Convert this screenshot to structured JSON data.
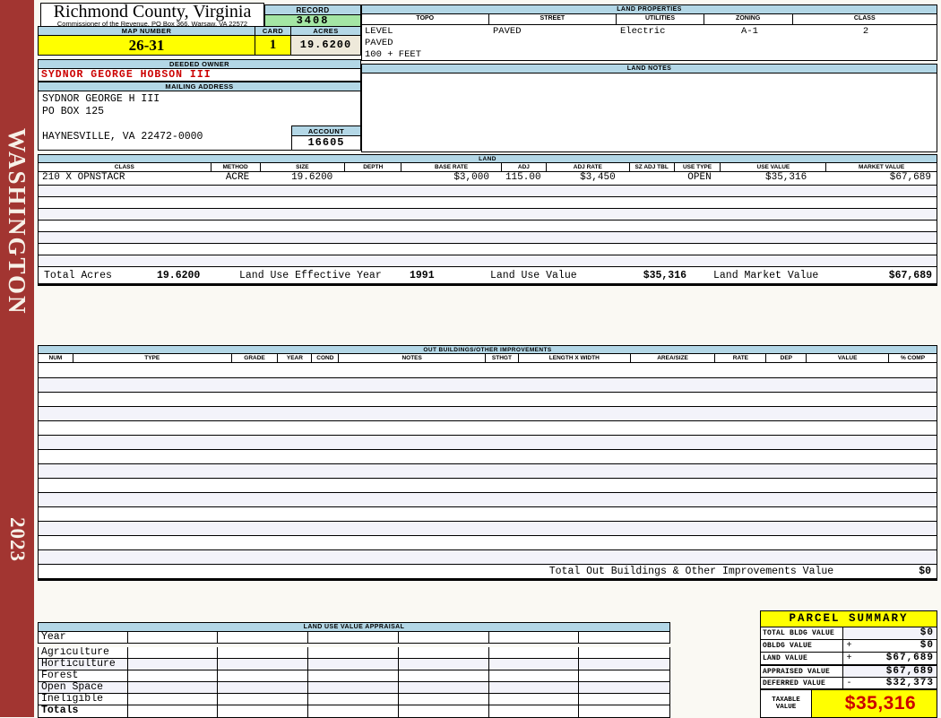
{
  "colors": {
    "sidebar_red": "#a23531",
    "header_blue": "#b3d7e6",
    "record_green": "#a4e6a4",
    "accent_yellow": "#ffff00",
    "acres_beige": "#eee9da",
    "owner_red": "#cc0000",
    "row_stripe": "#f3f3fa"
  },
  "sidebar": {
    "district": "WASHINGTON",
    "year": "2023"
  },
  "header": {
    "title": "Richmond County, Virginia",
    "subtitle": "Commissioner of the Revenue, PO Box 366, Warsaw, VA 22572",
    "record_label": "RECORD",
    "record_value": "3408",
    "map_number_label": "MAP NUMBER",
    "map_number": "26-31",
    "card_label": "CARD",
    "card": "1",
    "acres_label": "ACRES",
    "acres": "19.6200"
  },
  "land_properties": {
    "title": "LAND PROPERTIES",
    "columns": [
      "TOPO",
      "STREET",
      "UTILITIES",
      "ZONING",
      "CLASS"
    ],
    "topo_lines": [
      "LEVEL",
      "PAVED",
      "100 + FEET"
    ],
    "street": "PAVED",
    "utilities": "Electric",
    "zoning": "A-1",
    "class": "2"
  },
  "owner": {
    "deeded_owner_label": "DEEDED OWNER",
    "deeded_owner": "SYDNOR GEORGE HOBSON III",
    "mailing_address_label": "MAILING ADDRESS",
    "mailing_lines": [
      "SYDNOR GEORGE H III",
      "PO BOX 125",
      "",
      "HAYNESVILLE, VA 22472-0000"
    ],
    "account_label": "ACCOUNT",
    "account": "16605"
  },
  "land_notes": {
    "title": "LAND NOTES"
  },
  "land_table": {
    "title": "LAND",
    "columns": [
      "CLASS",
      "METHOD",
      "SIZE",
      "DEPTH",
      "BASE RATE",
      "ADJ",
      "ADJ RATE",
      "SZ ADJ TBL",
      "USE TYPE",
      "USE VALUE",
      "MARKET VALUE"
    ],
    "rows": [
      [
        "210 X OPNSTACR",
        "ACRE",
        "19.6200",
        "",
        "$3,000",
        "115.00",
        "$3,450",
        "",
        "OPEN",
        "$35,316",
        "$67,689"
      ]
    ],
    "empty_row_count": 7,
    "totals": {
      "total_acres_label": "Total Acres",
      "total_acres": "19.6200",
      "effective_year_label": "Land Use Effective Year",
      "effective_year": "1991",
      "use_value_label": "Land Use Value",
      "use_value": "$35,316",
      "market_value_label": "Land Market Value",
      "market_value": "$67,689"
    }
  },
  "out_buildings": {
    "title": "OUT BUILDINGS/OTHER IMPROVEMENTS",
    "columns": [
      "NUM",
      "TYPE",
      "GRADE",
      "YEAR",
      "COND",
      "NOTES",
      "STHGT",
      "LENGTH X WIDTH",
      "AREA/SIZE",
      "RATE",
      "DEP",
      "VALUE",
      "% COMP"
    ],
    "empty_row_count": 14,
    "total_label": "Total Out Buildings & Other Improvements Value",
    "total_value": "$0"
  },
  "land_use_appraisal": {
    "title": "LAND USE VALUE APPRAISAL",
    "row_labels": [
      "Year",
      "Agriculture",
      "Horticulture",
      "Forest",
      "Open Space",
      "Ineligible",
      "Totals"
    ],
    "data_column_count": 6
  },
  "parcel_summary": {
    "title": "PARCEL SUMMARY",
    "rows": [
      {
        "label": "TOTAL BLDG VALUE",
        "op": "",
        "value": "$0"
      },
      {
        "label": "OBLDG VALUE",
        "op": "+",
        "value": "$0"
      },
      {
        "label": "LAND VALUE",
        "op": "+",
        "value": "$67,689"
      },
      {
        "label": "APPRAISED VALUE",
        "op": "",
        "value": "$67,689"
      },
      {
        "label": "DEFERRED VALUE",
        "op": "-",
        "value": "$32,373"
      }
    ],
    "taxable_label_line1": "TAXABLE",
    "taxable_label_line2": "VALUE",
    "taxable_value": "$35,316"
  }
}
